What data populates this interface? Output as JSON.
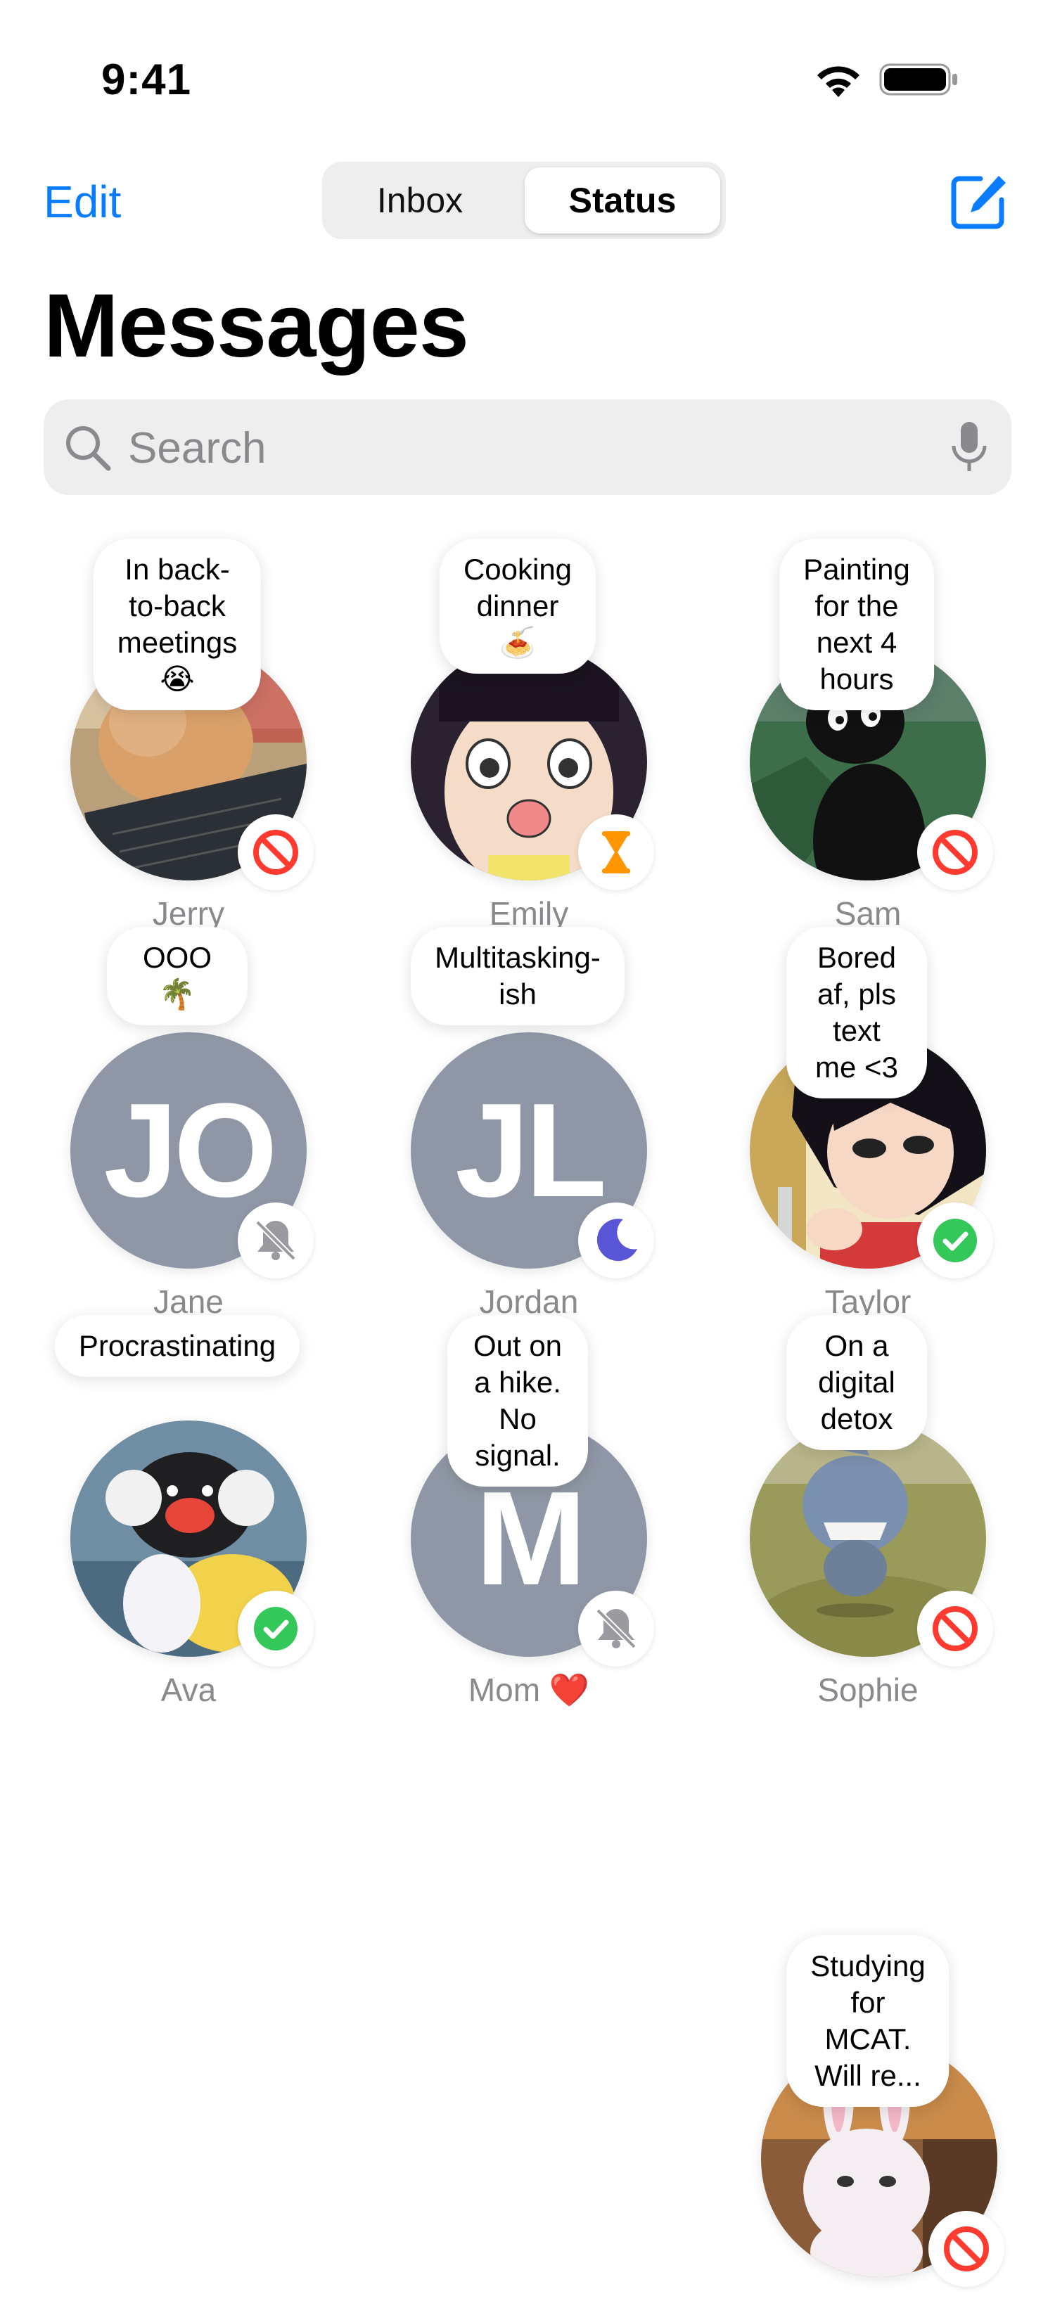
{
  "status_bar": {
    "time": "9:41"
  },
  "nav": {
    "edit_label": "Edit",
    "tabs": [
      {
        "label": "Inbox"
      },
      {
        "label": "Status"
      }
    ],
    "selected_tab": "Status"
  },
  "page_title": "Messages",
  "search": {
    "placeholder": "Search"
  },
  "contacts": [
    {
      "name": "Jerry",
      "status": "In back-to-back\nmeetings 😭",
      "badge": "do-not-disturb-icon",
      "avatar": "photo-cat"
    },
    {
      "name": "Emily",
      "status": "Cooking dinner 🍝",
      "badge": "hourglass-icon",
      "avatar": "illustration-girl"
    },
    {
      "name": "Sam",
      "status": "Painting for the\nnext 4 hours",
      "badge": "do-not-disturb-icon",
      "avatar": "illustration-black-cat"
    },
    {
      "name": "Jane",
      "status": "OOO 🌴",
      "badge": "bell-slash-icon",
      "initials": "JO"
    },
    {
      "name": "Jordan",
      "status": "Multitasking-ish",
      "badge": "moon-icon",
      "initials": "JL"
    },
    {
      "name": "Taylor",
      "status": "Bored af, pls\ntext me <3",
      "badge": "checkmark-badge-icon",
      "avatar": "illustration-anime-girl"
    },
    {
      "name": "Ava",
      "status": "Procrastinating",
      "badge": "checkmark-badge-icon",
      "avatar": "photo-penguin-plush"
    },
    {
      "name": "Mom ❤️",
      "status": "Out on a hike.\nNo signal.",
      "badge": "bell-slash-icon",
      "initials": "M"
    },
    {
      "name": "Sophie",
      "status": "On a digital\ndetox",
      "badge": "do-not-disturb-icon",
      "avatar": "photo-shark-plush"
    },
    {
      "name": "",
      "status": "Studying for\nMCAT. Will re...",
      "badge": "do-not-disturb-icon",
      "avatar": "photo-bunny-plush"
    }
  ],
  "colors": {
    "accent": "#0a7cff",
    "dnd": "#ff3b30",
    "hourglass": "#ff9500",
    "moon": "#5856d6",
    "check": "#34c759",
    "avatar_gray": "#8f97a6"
  }
}
